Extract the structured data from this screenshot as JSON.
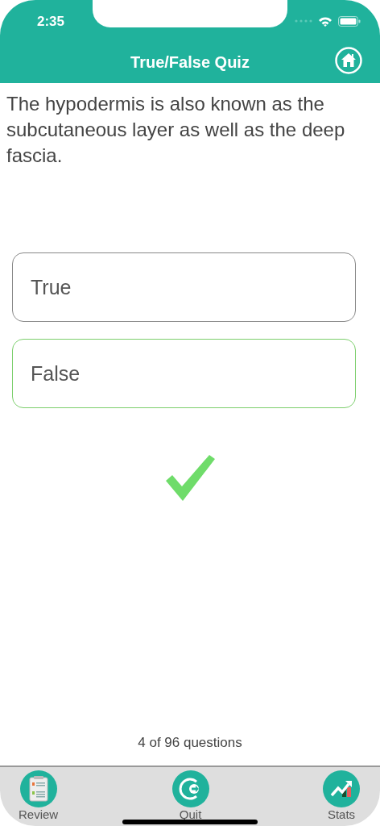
{
  "status_bar": {
    "time": "2:35"
  },
  "header": {
    "title": "True/False Quiz"
  },
  "question": "The hypodermis is also known as the subcutaneous layer as well as the deep fascia.",
  "answers": [
    {
      "label": "True",
      "correct": false
    },
    {
      "label": "False",
      "correct": true
    }
  ],
  "answered_correctly": true,
  "progress": "4 of 96 questions",
  "tab_bar": [
    {
      "kind": "review",
      "label": "Review"
    },
    {
      "kind": "quit",
      "label": "Quit"
    },
    {
      "kind": "stats",
      "label": "Stats"
    }
  ]
}
